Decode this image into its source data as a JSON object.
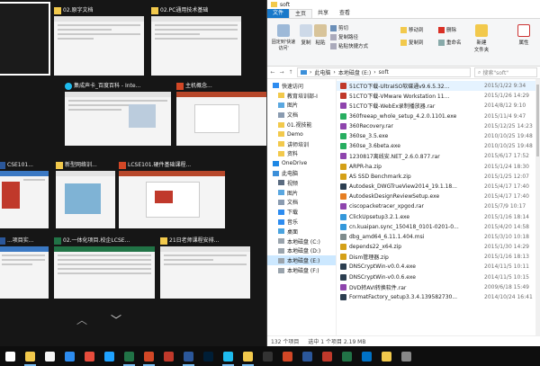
{
  "task_view": {
    "windows": [
      {
        "title": "",
        "selected": true
      },
      {
        "title": "02.原字文档",
        "icon": "folder-icon"
      },
      {
        "title": "02.PC通用技术基础",
        "icon": "folder-icon"
      },
      {
        "title": "集成声卡_百度百科 - Inte...",
        "icon": "ie-icon"
      },
      {
        "title": "主机概念...",
        "icon": "powerpoint-icon"
      },
      {
        "title": "CSE101...",
        "icon": "word-icon"
      },
      {
        "title": "新型网络训...",
        "icon": "folder-icon"
      },
      {
        "title": "LCSE101.硬件基础课程...",
        "icon": "powerpoint-icon"
      },
      {
        "title": "...项目实...",
        "icon": "word-icon"
      },
      {
        "title": "02.一体化项目.校企LCSE...",
        "icon": "excel-icon"
      },
      {
        "title": "21日老师课程安排...",
        "icon": "folder-icon"
      }
    ],
    "nav_up": "︿",
    "nav_down": "﹀"
  },
  "explorer": {
    "title": "soft",
    "tabs": [
      "文件",
      "主页",
      "共享",
      "查看"
    ],
    "ribbon": {
      "pin_label": "固定到'快速访问'",
      "copy_label": "复制",
      "paste_label": "粘贴",
      "cut_label": "剪切",
      "copy_path_label": "复制路径",
      "paste_shortcut_label": "粘贴快捷方式",
      "move_to_label": "移动到",
      "copy_to_label": "复制到",
      "delete_label": "删除",
      "rename_label": "重命名",
      "new_folder_label": "新建\n文件夹",
      "properties_label": "属性"
    },
    "address": {
      "path": [
        "此电脑",
        "本地磁盘 (E:)",
        "soft"
      ],
      "search_placeholder": "搜索\"soft\""
    },
    "nav_items": [
      {
        "label": "快速访问",
        "icon": "star-icon",
        "level": 0
      },
      {
        "label": "教育培训部-I",
        "icon": "folder-icon",
        "level": 1
      },
      {
        "label": "图片",
        "icon": "pictures-icon",
        "level": 1
      },
      {
        "label": "文档",
        "icon": "documents-icon",
        "level": 1
      },
      {
        "label": "01.视技能",
        "icon": "folder-icon",
        "level": 1
      },
      {
        "label": "Demo",
        "icon": "folder-icon",
        "level": 1
      },
      {
        "label": "讲师培训",
        "icon": "folder-icon",
        "level": 1
      },
      {
        "label": "资料",
        "icon": "folder-icon",
        "level": 1
      },
      {
        "label": "OneDrive",
        "icon": "cloud-icon",
        "level": 0
      },
      {
        "label": "此电脑",
        "icon": "computer-icon",
        "level": 0
      },
      {
        "label": "视频",
        "icon": "videos-icon",
        "level": 1
      },
      {
        "label": "图片",
        "icon": "pictures-icon",
        "level": 1
      },
      {
        "label": "文档",
        "icon": "documents-icon",
        "level": 1
      },
      {
        "label": "下载",
        "icon": "download-icon",
        "level": 1
      },
      {
        "label": "音乐",
        "icon": "music-icon",
        "level": 1
      },
      {
        "label": "桌面",
        "icon": "desktop-icon",
        "level": 1
      },
      {
        "label": "本地磁盘 (C:)",
        "icon": "drive-icon",
        "level": 1
      },
      {
        "label": "本地磁盘 (D:)",
        "icon": "drive-icon",
        "level": 1
      },
      {
        "label": "本地磁盘 (E:)",
        "icon": "drive-icon",
        "level": 1,
        "selected": true
      },
      {
        "label": "本地磁盘 (F:)",
        "icon": "drive-icon",
        "level": 1
      }
    ],
    "files": [
      {
        "name": "51CTO下载-UltraISO软碟通v9.6.5.32...",
        "date": "2015/1/22 9:34",
        "color": "#c0392b",
        "highlighted": true
      },
      {
        "name": "51CTO下载-VMware Workstation 11...",
        "date": "2015/1/26 14:29",
        "color": "#c0392b"
      },
      {
        "name": "51CTO下载-WebEx录制播放器.rar",
        "date": "2014/8/12 9:10",
        "color": "#8e44ad"
      },
      {
        "name": "360freeap_whole_setup_4.2.0.1101.exe",
        "date": "2015/11/4 9:47",
        "color": "#27ae60"
      },
      {
        "name": "360Recovery.rar",
        "date": "2015/12/25 14:23",
        "color": "#8e44ad"
      },
      {
        "name": "360se_3.5.exe",
        "date": "2010/10/25 19:48",
        "color": "#27ae60"
      },
      {
        "name": "360se_3.6beta.exe",
        "date": "2010/10/25 19:48",
        "color": "#27ae60"
      },
      {
        "name": "1230817离线安.NET_2.6.0.877.rar",
        "date": "2015/6/17 17:52",
        "color": "#8e44ad"
      },
      {
        "name": "ARPR-ha.zip",
        "date": "2015/1/24 18:30",
        "color": "#d4a017"
      },
      {
        "name": "AS SSD Benchmark.zip",
        "date": "2015/1/25 12:07",
        "color": "#d4a017"
      },
      {
        "name": "Autodesk_DWGTrueView2014_19.1.18...",
        "date": "2015/4/17 17:40",
        "color": "#2c3e50"
      },
      {
        "name": "AutodeskDesignReviewSetup.exe",
        "date": "2015/4/17 17:40",
        "color": "#e67e22"
      },
      {
        "name": "ciscopacketracer_xpgod.rar",
        "date": "2015/7/9 10:17",
        "color": "#8e44ad"
      },
      {
        "name": "ClickUpsetup3.2.1.exe",
        "date": "2015/1/16 18:14",
        "color": "#3498db"
      },
      {
        "name": "cn.kuaipan.sync_150418_0101-0201-0...",
        "date": "2015/4/20 14:58",
        "color": "#3498db"
      },
      {
        "name": "dbg_amd64_6.11.1.404.msi",
        "date": "2015/3/10 10:18",
        "color": "#7f8c8d"
      },
      {
        "name": "depends22_x64.zip",
        "date": "2015/1/30 14:29",
        "color": "#d4a017"
      },
      {
        "name": "Dism管理器.zip",
        "date": "2015/1/16 18:13",
        "color": "#d4a017"
      },
      {
        "name": "DNSCryptWin-v0.0.4.exe",
        "date": "2014/11/5 10:11",
        "color": "#2c3e50"
      },
      {
        "name": "DNSCryptWin-v0.0.6.exe",
        "date": "2014/11/5 10:15",
        "color": "#2c3e50"
      },
      {
        "name": "DVD转AVI转换软件.rar",
        "date": "2009/6/18 15:49",
        "color": "#8e44ad"
      },
      {
        "name": "FormatFactory_setup3.3.4.139582730...",
        "date": "2014/10/24 16:41",
        "color": "#2c3e50"
      }
    ],
    "status": {
      "count": "132 个项目",
      "selected": "选中 1 个项目  2.19 MB"
    }
  },
  "taskbar": {
    "items": [
      {
        "icon": "start-icon",
        "color": "#ffffff"
      },
      {
        "icon": "folder-icon",
        "color": "#f2c94c",
        "active": true
      },
      {
        "icon": "store-icon",
        "color": "#f5f5f5"
      },
      {
        "icon": "mail-icon",
        "color": "#2d8cf0"
      },
      {
        "icon": "chrome-icon",
        "color": "#e74c3c"
      },
      {
        "icon": "media-icon",
        "color": "#1fa2ff"
      },
      {
        "icon": "excel-icon",
        "color": "#217346",
        "active": true
      },
      {
        "icon": "powerpoint-icon",
        "color": "#d24726",
        "active": true
      },
      {
        "icon": "pdf-icon",
        "color": "#c0392b"
      },
      {
        "icon": "word-icon",
        "color": "#2b579a",
        "active": true
      },
      {
        "icon": "photoshop-icon",
        "color": "#001e36"
      },
      {
        "icon": "ie-icon",
        "color": "#1ebbee",
        "active": true
      },
      {
        "icon": "explorer-icon",
        "color": "#f2c94c",
        "active": true
      },
      {
        "icon": "terminal-icon",
        "color": "#333333"
      },
      {
        "icon": "powerpoint-icon",
        "color": "#d24726"
      },
      {
        "icon": "word-icon",
        "color": "#2b579a"
      },
      {
        "icon": "pdf-icon",
        "color": "#c0392b"
      },
      {
        "icon": "excel-icon",
        "color": "#217346"
      },
      {
        "icon": "outlook-icon",
        "color": "#0072c6"
      },
      {
        "icon": "folder-icon",
        "color": "#f2c94c"
      },
      {
        "icon": "settings-icon",
        "color": "#888888"
      }
    ]
  },
  "colors": {
    "accent": "#1979ca",
    "task_view_bg": "#161616",
    "selection": "#cce8ff"
  }
}
